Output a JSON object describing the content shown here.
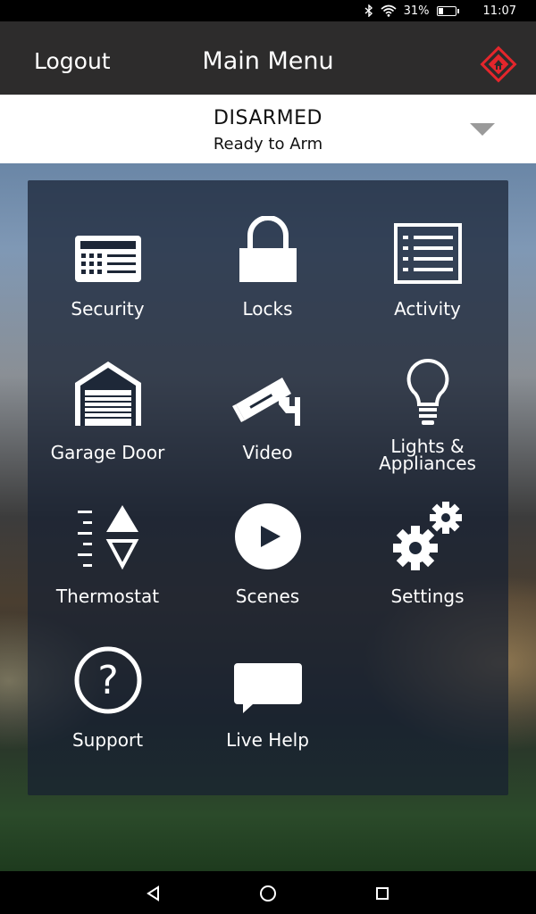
{
  "status_bar": {
    "battery_percent": "31%",
    "battery_level": 0.31,
    "time": "11:07",
    "icons": [
      "bluetooth-icon",
      "wifi-icon",
      "battery-icon"
    ]
  },
  "header": {
    "logout_label": "Logout",
    "title": "Main Menu",
    "brand_icon": "home-shield-icon",
    "brand_color": "#e4262c",
    "background": "#2d2c2c"
  },
  "arm_status": {
    "state": "DISARMED",
    "subtitle": "Ready to Arm",
    "caret_icon": "dropdown-caret-icon"
  },
  "menu": {
    "items": [
      {
        "label": "Security",
        "icon": "keypad-icon"
      },
      {
        "label": "Locks",
        "icon": "lock-icon"
      },
      {
        "label": "Activity",
        "icon": "list-icon"
      },
      {
        "label": "Garage Door",
        "icon": "garage-icon"
      },
      {
        "label": "Video",
        "icon": "camera-icon"
      },
      {
        "label": "Lights &",
        "label2": "Appliances",
        "icon": "lightbulb-icon"
      },
      {
        "label": "Thermostat",
        "icon": "thermostat-icon"
      },
      {
        "label": "Scenes",
        "icon": "play-icon"
      },
      {
        "label": "Settings",
        "icon": "gears-icon"
      },
      {
        "label": "Support",
        "icon": "question-icon"
      },
      {
        "label": "Live Help",
        "icon": "chat-bubble-icon"
      }
    ]
  },
  "nav_bar": {
    "icons": [
      "back-icon",
      "home-icon",
      "recents-icon"
    ]
  }
}
